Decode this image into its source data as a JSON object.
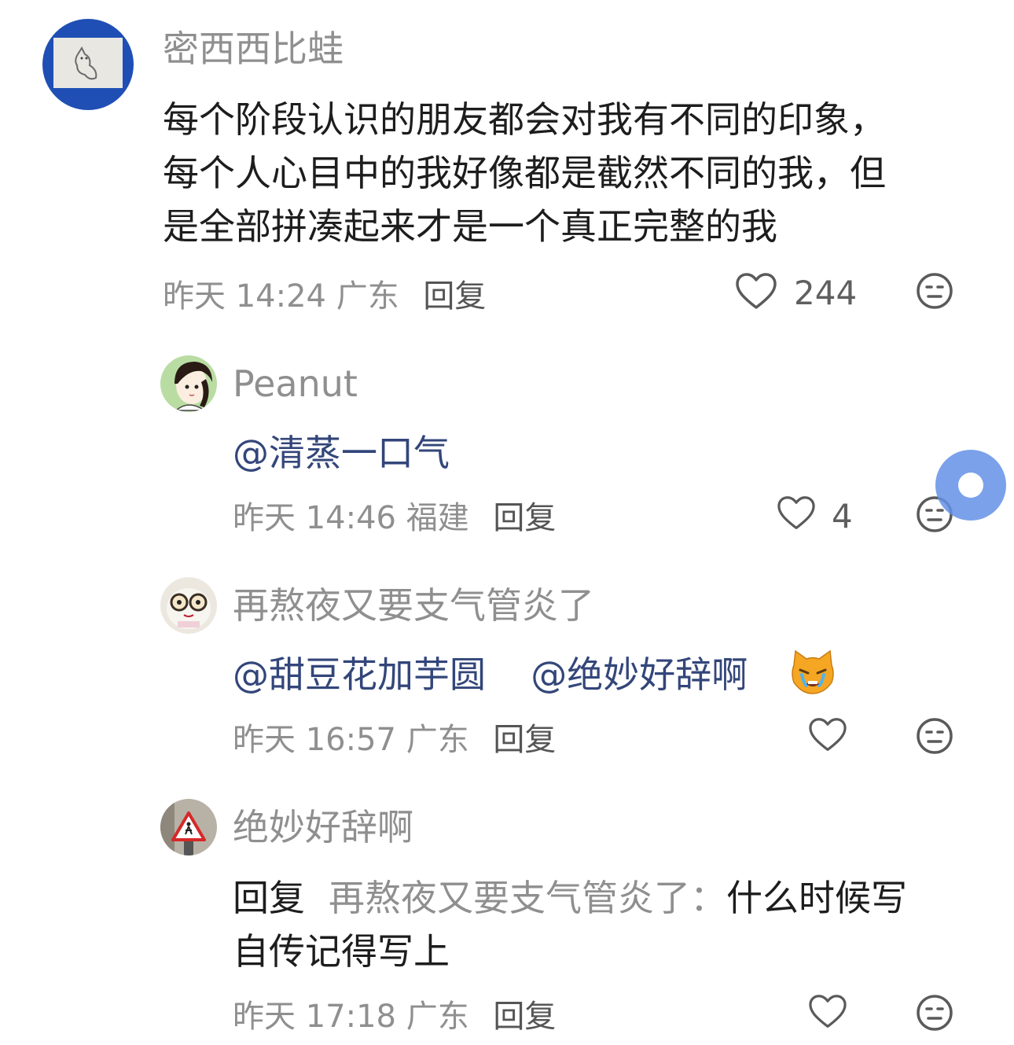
{
  "comments": [
    {
      "username": "密西西比蛙",
      "text_lines": [
        "每个阶段认识的朋友都会对我有不同的印象，",
        "每个人心目中的我好像都是截然不同的我，但",
        "是全部拼凑起来才是一个真正完整的我"
      ],
      "meta": "昨天 14:24 广东",
      "reply_label": "回复",
      "likes": "244"
    }
  ],
  "replies": [
    {
      "username": "Peanut",
      "mention": "@清蒸一口气",
      "meta": "昨天 14:46 福建",
      "reply_label": "回复",
      "likes": "4"
    },
    {
      "username": "再熬夜又要支气管炎了",
      "mention_1": "@甜豆花加芋圆",
      "mention_2": "@绝妙好辞啊",
      "emoji": "😿",
      "meta": "昨天 16:57 广东",
      "reply_label": "回复"
    },
    {
      "username": "绝妙好辞啊",
      "reply_prefix": "回复",
      "reply_to": "再熬夜又要支气管炎了：",
      "text_line1": "什么时候写",
      "text_line2": "自传记得写上",
      "meta": "昨天 17:18 广东",
      "reply_label": "回复"
    }
  ],
  "icons": {
    "like": "heart-outline-icon",
    "dislike": "neutral-face-icon"
  },
  "colors": {
    "username": "#8f8f8f",
    "mention": "#33467a",
    "floating_ball": "#6491e6"
  }
}
